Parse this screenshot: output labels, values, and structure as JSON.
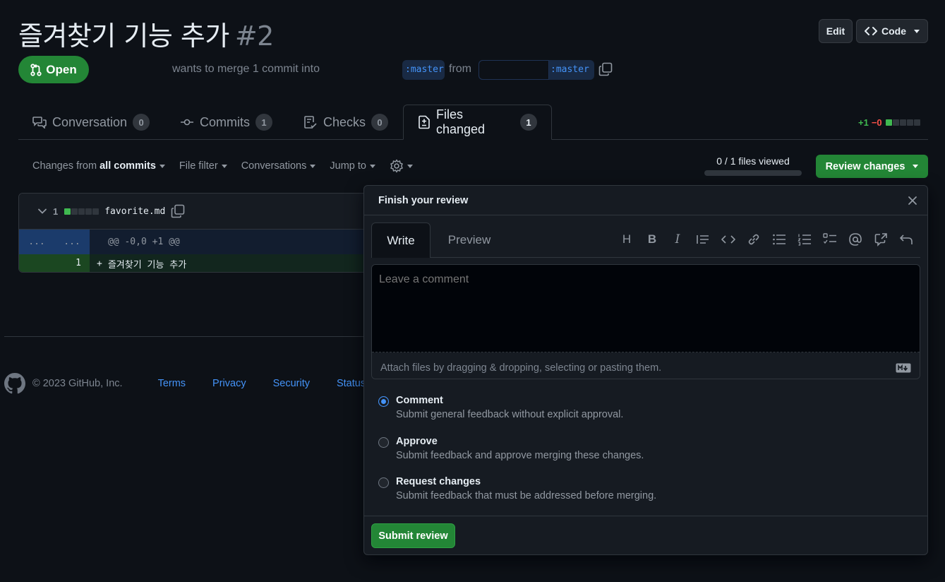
{
  "header": {
    "title": "즐겨찾기 기능 추가",
    "number": "#2",
    "edit_label": "Edit",
    "code_label": "Code",
    "state": "Open",
    "merge_text": "wants to merge 1 commit into",
    "base_branch": ":master",
    "from_text": "from",
    "head_branch": ":master"
  },
  "tabs": [
    {
      "label": "Conversation",
      "count": "0"
    },
    {
      "label": "Commits",
      "count": "1"
    },
    {
      "label": "Checks",
      "count": "0"
    },
    {
      "label": "Files changed",
      "count": "1"
    }
  ],
  "diffstat": {
    "additions": "+1",
    "deletions": "−0"
  },
  "toolbar": {
    "changes_prefix": "Changes from",
    "changes_value": "all commits",
    "file_filter": "File filter",
    "conversations": "Conversations",
    "jump_to": "Jump to",
    "files_viewed": "0 / 1 files viewed",
    "files_viewed_progress": 0,
    "review_changes": "Review changes"
  },
  "file": {
    "changes_count": "1",
    "name": "favorite.md",
    "hunk_left": "...",
    "hunk_right": "...",
    "hunk_header": "@@ -0,0 +1 @@",
    "line_number": "1",
    "line_marker": "+",
    "line_content": "즐겨찾기 기능 추가"
  },
  "footer": {
    "copyright": "© 2023 GitHub, Inc.",
    "links": [
      "Terms",
      "Privacy",
      "Security",
      "Status"
    ]
  },
  "review": {
    "title": "Finish your review",
    "write_tab": "Write",
    "preview_tab": "Preview",
    "heading_tool": "H",
    "bold_tool": "B",
    "italic_tool": "I",
    "placeholder": "Leave a comment",
    "attach_text": "Attach files by dragging & dropping, selecting or pasting them.",
    "options": [
      {
        "title": "Comment",
        "desc": "Submit general feedback without explicit approval.",
        "checked": true
      },
      {
        "title": "Approve",
        "desc": "Submit feedback and approve merging these changes.",
        "checked": false
      },
      {
        "title": "Request changes",
        "desc": "Submit feedback that must be addressed before merging.",
        "checked": false
      }
    ],
    "submit_label": "Submit review"
  },
  "colors": {
    "accent_green": "#238636",
    "link_blue": "#4493f8",
    "addition": "#3fb950",
    "deletion": "#f85149"
  }
}
